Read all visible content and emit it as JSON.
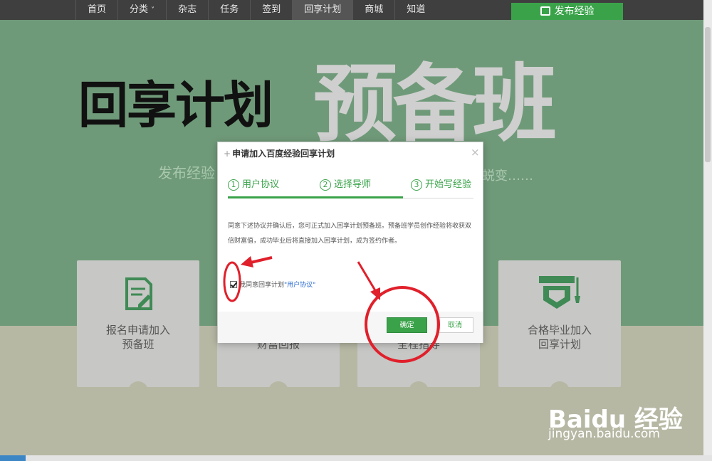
{
  "nav": {
    "items": [
      "首页",
      "分类",
      "杂志",
      "任务",
      "签到",
      "回享计划",
      "商城",
      "知道"
    ],
    "category_arrow": "˅",
    "active_index": 5,
    "publish_label": "发布经验"
  },
  "hero": {
    "title_black": "回享计划",
    "title_gray": "预备班",
    "subtitle_left": "发布经验",
    "subtitle_right": "蜕变……"
  },
  "cards": [
    {
      "line1": "报名申请加入",
      "line2": "预备班"
    },
    {
      "line1": "财富回报",
      "line2": ""
    },
    {
      "line1": "全程指导",
      "line2": ""
    },
    {
      "line1": "合格毕业加入",
      "line2": "回享计划"
    }
  ],
  "dialog": {
    "title": "申请加入百度经验回享计划",
    "close_symbol": "×",
    "steps": [
      {
        "num": "1",
        "label": "用户协议"
      },
      {
        "num": "2",
        "label": "选择导师"
      },
      {
        "num": "3",
        "label": "开始写经验"
      }
    ],
    "description": "同意下述协议并确认后，您可正式加入回享计划预备班。预备班学员创作经验将收获双倍财富值，成功毕业后将直接加入回享计划，成为签约作者。",
    "agree_prefix": "我同意回享计划",
    "agree_link": "\"用户协议\"",
    "agree_checked": true,
    "ok_label": "确定",
    "cancel_label": "取消"
  },
  "watermark": {
    "brand": "Bai",
    "brand_paw": "du",
    "brand_cn": "经验",
    "url": "jingyan.baidu.com"
  },
  "colors": {
    "accent_green": "#3aa34a",
    "hero_green": "#6f9a79",
    "annotation_red": "#e0202b"
  }
}
